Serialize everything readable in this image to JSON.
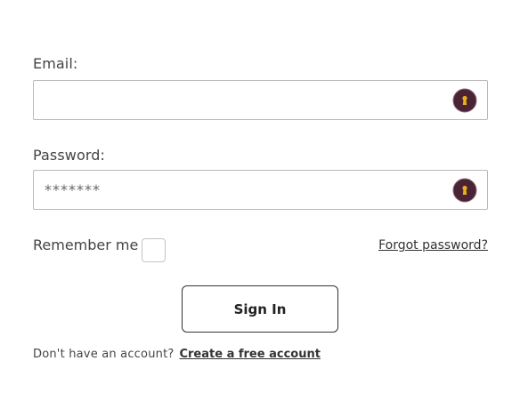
{
  "login_form": {
    "email": {
      "label": "Email:",
      "value": "",
      "placeholder": ""
    },
    "password": {
      "label": "Password:",
      "value": "",
      "placeholder": "*******"
    },
    "remember_me": {
      "label": "Remember me",
      "checked": false
    },
    "forgot_password_label": "Forgot password?",
    "sign_in_label": "Sign In",
    "signup_prompt": "Don't have an account?",
    "create_account_label": "Create a free account",
    "field_icon": "keyhole-icon",
    "colors": {
      "icon_circle": "#4a2334",
      "icon_keyhole": "#e8b21a",
      "field_border": "#b9b9b9",
      "button_border": "#333333"
    }
  }
}
